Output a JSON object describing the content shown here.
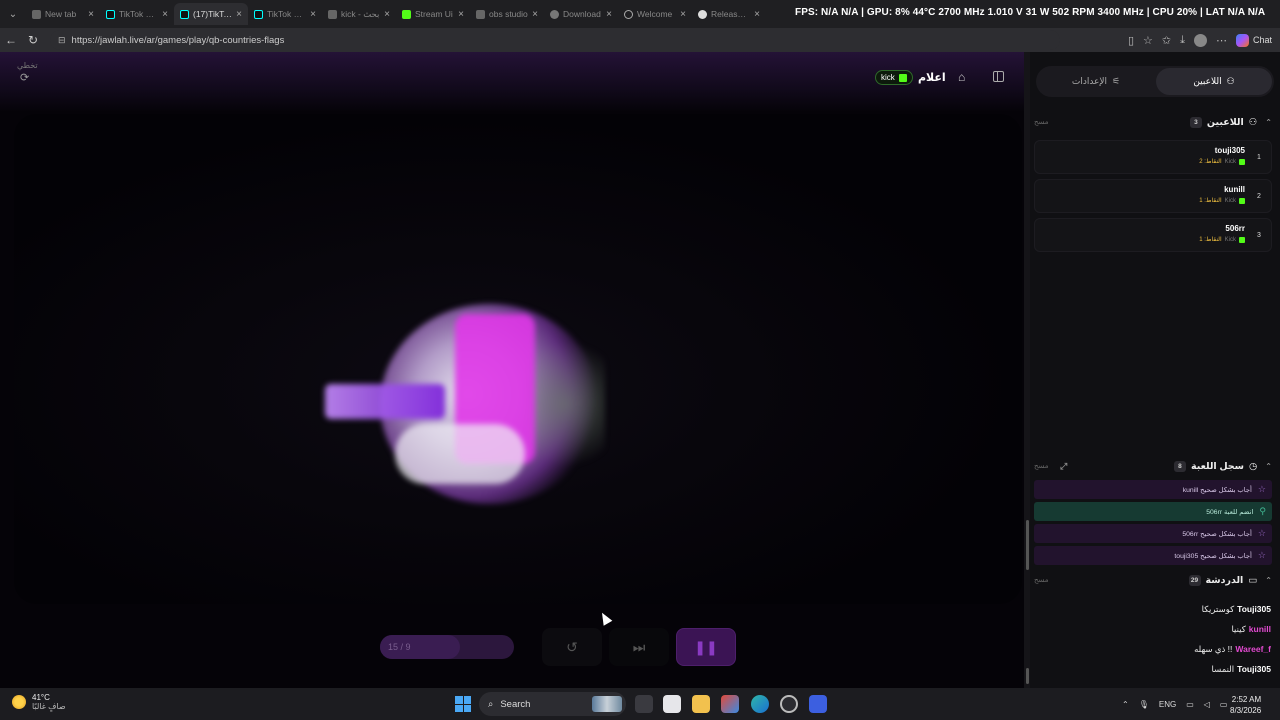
{
  "browser": {
    "tabs": [
      {
        "title": "New tab",
        "icon": "new-tab-icon"
      },
      {
        "title": "TikTok LIVE",
        "icon": "tiktok-icon"
      },
      {
        "title": "(17)TikTok",
        "icon": "tiktok-icon"
      },
      {
        "title": "TikTok LIVE",
        "icon": "tiktok-icon"
      },
      {
        "title": "kick - بحث",
        "icon": "search-icon"
      },
      {
        "title": "Stream Ui",
        "icon": "kick-icon"
      },
      {
        "title": "obs studio",
        "icon": "obs-icon"
      },
      {
        "title": "Download",
        "icon": "download-icon"
      },
      {
        "title": "Welcome",
        "icon": "globe-icon"
      },
      {
        "title": "Release O",
        "icon": "github-icon"
      }
    ],
    "active_tab_index": 2,
    "stats_overlay": "FPS: N/A  N/A  | GPU: 8%  44°C 2700 MHz  1.010 V  31 W  502 RPM  3400 MHz  | CPU 20%  | LAT  N/A  N/A",
    "url": "https://jawlah.live/ar/games/play/qb-countries-flags",
    "chat_label": "Chat"
  },
  "game": {
    "skip_label": "تخطي",
    "title": "اعلام",
    "platform_badge": "kick",
    "progress_text": "15 / 9",
    "progress_fraction": 0.6
  },
  "sidebar": {
    "tab_players": "اللاعبين",
    "tab_settings": "الإعدادات",
    "players_header": "اللاعبين",
    "players_count": "3",
    "clear_label": "مسح",
    "players": [
      {
        "rank": "1",
        "name": "touji305",
        "platform": "Kick",
        "points": "النقاط: 2"
      },
      {
        "rank": "2",
        "name": "kunill",
        "platform": "Kick",
        "points": "النقاط: 1"
      },
      {
        "rank": "3",
        "name": "506rr",
        "platform": "Kick",
        "points": "النقاط: 1"
      }
    ],
    "log_header": "سجل اللعبة",
    "log_count": "8",
    "log_items": [
      {
        "text": "kunill أجاب بشكل صحيح",
        "type": "correct"
      },
      {
        "text": "506rr انضم للعبة",
        "type": "joined"
      },
      {
        "text": "506rr أجاب بشكل صحيح",
        "type": "correct"
      },
      {
        "text": "touji305 أجاب بشكل صحيح",
        "type": "correct"
      }
    ],
    "chat_header": "الدردشة",
    "chat_count": "29",
    "chat_messages": [
      {
        "user": "Touji305",
        "message": "كوستريكا",
        "color": "#ffffff"
      },
      {
        "user": "kunill",
        "message": "كينيا",
        "color": "#e34ad1"
      },
      {
        "user": "Wareef_f",
        "message": "ذي سهله !!",
        "color": "#e34ad1"
      },
      {
        "user": "Touji305",
        "message": "النمسا",
        "color": "#ffffff"
      }
    ]
  },
  "taskbar": {
    "temperature": "41°C",
    "weather_text": "صافٍ غالبًا",
    "search_placeholder": "Search",
    "language": "ENG",
    "time": "2:52 AM",
    "date": "8/3/2026"
  },
  "colors": {
    "accent": "#3b1454",
    "kick_green": "#53fc18",
    "points_gold": "#f0c040"
  }
}
